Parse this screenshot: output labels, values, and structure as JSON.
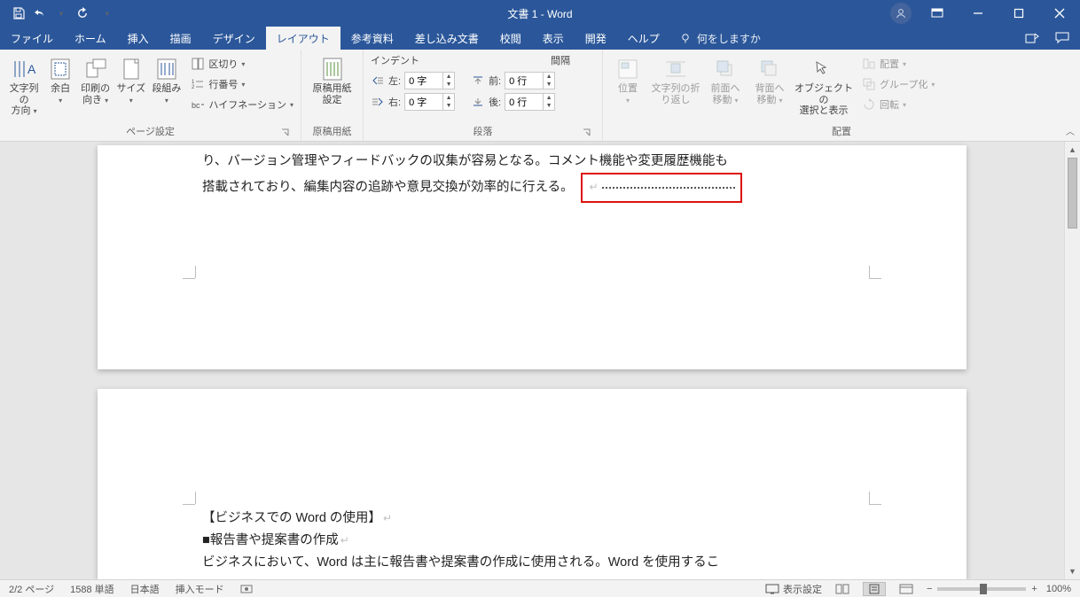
{
  "title": "文書 1  -  Word",
  "tabs": {
    "file": "ファイル",
    "home": "ホーム",
    "insert": "挿入",
    "draw": "描画",
    "design": "デザイン",
    "layout": "レイアウト",
    "references": "参考資料",
    "mailings": "差し込み文書",
    "review": "校閲",
    "view": "表示",
    "developer": "開発",
    "help": "ヘルプ",
    "tell_me": "何をしますか"
  },
  "ribbon": {
    "page_setup": {
      "label": "ページ設定",
      "text_direction": "文字列の\n方向",
      "margins": "余白",
      "orientation": "印刷の\n向き",
      "size": "サイズ",
      "columns": "段組み",
      "breaks": "区切り",
      "line_numbers": "行番号",
      "hyphenation": "ハイフネーション"
    },
    "manuscript": {
      "label": "原稿用紙",
      "button": "原稿用紙\n設定"
    },
    "paragraph": {
      "label": "段落",
      "indent_header": "インデント",
      "spacing_header": "間隔",
      "left_label": "左:",
      "right_label": "右:",
      "before_label": "前:",
      "after_label": "後:",
      "left_value": "0 字",
      "right_value": "0 字",
      "before_value": "0 行",
      "after_value": "0 行"
    },
    "arrange": {
      "label": "配置",
      "position": "位置",
      "wrap": "文字列の折\nり返し",
      "bring_forward": "前面へ\n移動",
      "send_backward": "背面へ\n移動",
      "selection_pane": "オブジェクトの\n選択と表示",
      "align": "配置",
      "group": "グループ化",
      "rotate": "回転"
    }
  },
  "document": {
    "p1_line1": "り、バージョン管理やフィードバックの収集が容易となる。コメント機能や変更履歴機能も",
    "p1_line2": "搭載されており、編集内容の追跡や意見交換が効率的に行える。",
    "p2_heading": "【ビジネスでの Word の使用】",
    "p2_sub": "■報告書や提案書の作成",
    "p2_body": "ビジネスにおいて、Word は主に報告書や提案書の作成に使用される。Word を使用するこ"
  },
  "status": {
    "page": "2/2 ページ",
    "words": "1588 単語",
    "lang": "日本語",
    "mode": "挿入モード",
    "display_settings": "表示設定",
    "zoom": "100%"
  }
}
